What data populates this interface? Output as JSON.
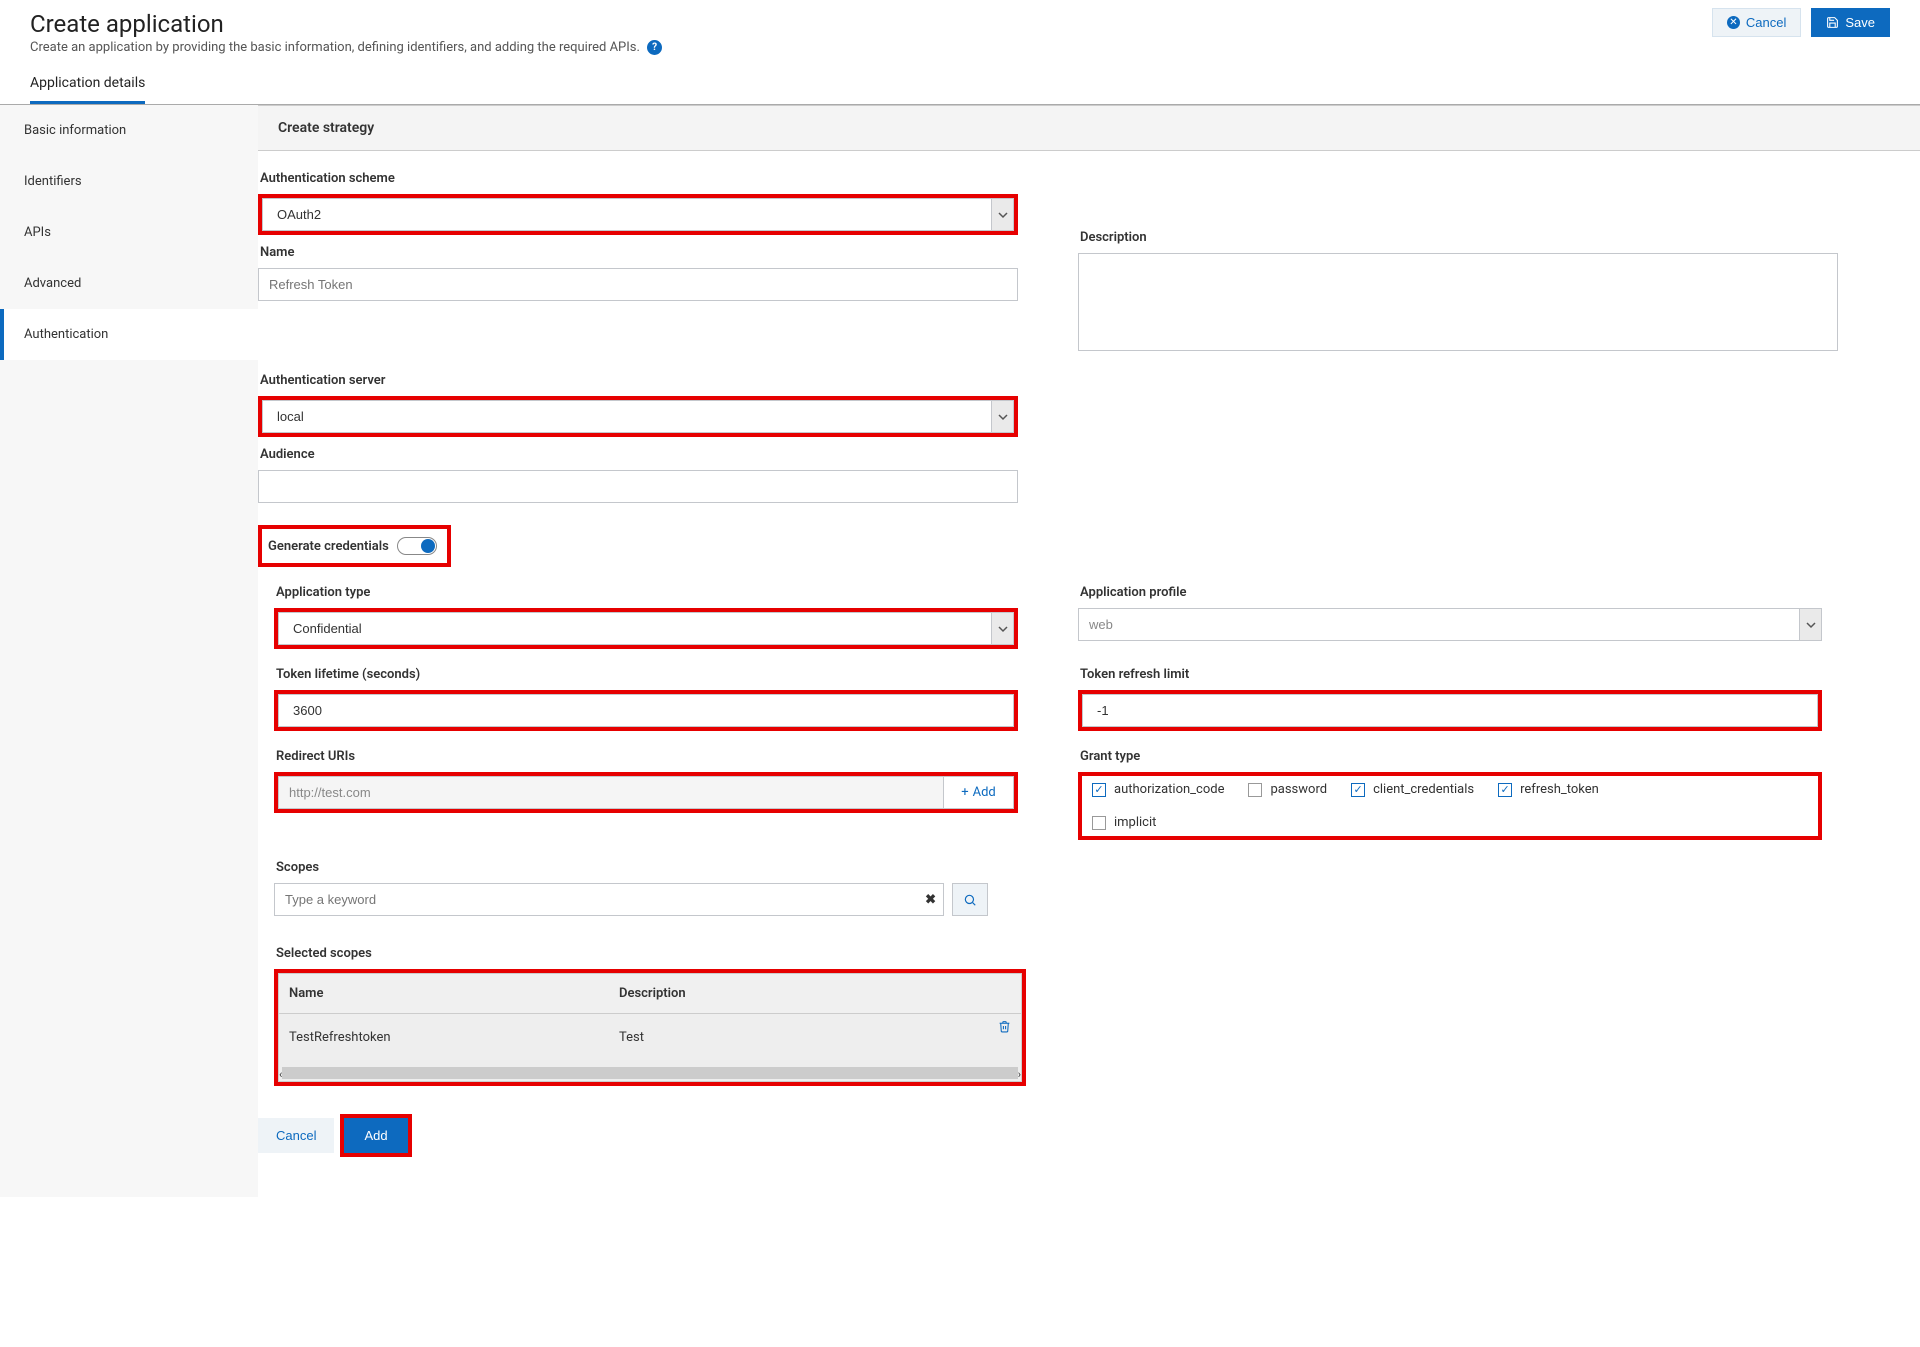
{
  "header": {
    "title": "Create application",
    "subtitle": "Create an application by providing the basic information, defining identifiers, and adding the required APIs.",
    "cancel_label": "Cancel",
    "save_label": "Save"
  },
  "tabs": {
    "active": "Application details"
  },
  "sidebar": {
    "items": [
      "Basic information",
      "Identifiers",
      "APIs",
      "Advanced",
      "Authentication"
    ],
    "active_index": 4
  },
  "panel": {
    "title": "Create strategy",
    "auth_scheme_label": "Authentication scheme",
    "auth_scheme_value": "OAuth2",
    "name_label": "Name",
    "name_placeholder": "Refresh Token",
    "description_label": "Description",
    "description_value": "",
    "auth_server_label": "Authentication server",
    "auth_server_value": "local",
    "audience_label": "Audience",
    "audience_value": "",
    "gen_cred_label": "Generate credentials",
    "gen_cred_on": true,
    "app_type_label": "Application type",
    "app_type_value": "Confidential",
    "app_profile_label": "Application profile",
    "app_profile_value": "web",
    "token_lifetime_label": "Token lifetime (seconds)",
    "token_lifetime_value": "3600",
    "token_refresh_label": "Token refresh limit",
    "token_refresh_value": "-1",
    "redirect_label": "Redirect URIs",
    "redirect_value": "http://test.com",
    "redirect_add_label": "Add",
    "grant_type_label": "Grant type",
    "grant_types": [
      {
        "label": "authorization_code",
        "checked": true
      },
      {
        "label": "password",
        "checked": false
      },
      {
        "label": "client_credentials",
        "checked": true
      },
      {
        "label": "refresh_token",
        "checked": true
      },
      {
        "label": "implicit",
        "checked": false
      }
    ],
    "scopes_label": "Scopes",
    "scopes_placeholder": "Type a keyword",
    "selected_scopes_label": "Selected scopes",
    "scopes_table": {
      "head_name": "Name",
      "head_desc": "Description",
      "row_name": "TestRefreshtoken",
      "row_desc": "Test"
    },
    "dialog_cancel": "Cancel",
    "dialog_add": "Add"
  }
}
